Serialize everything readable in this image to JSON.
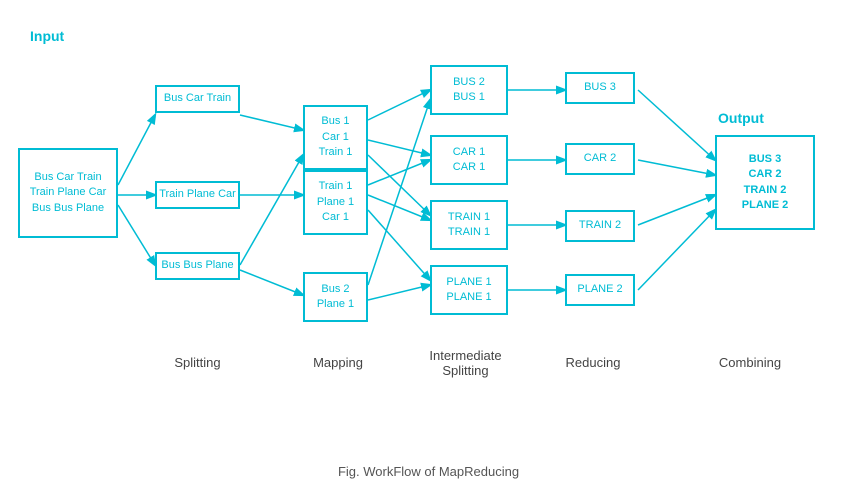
{
  "title": "Fig. WorkFlow of MapReducing",
  "labels": {
    "input": "Input",
    "output": "Output",
    "splitting": "Splitting",
    "mapping": "Mapping",
    "intermediate_splitting": "Intermediate\nSplitting",
    "reducing": "Reducing",
    "combining": "Combining",
    "fig": "Fig. WorkFlow of MapReducing"
  },
  "boxes": {
    "input": "Bus Car Train\nTrain Plane Car\nBus Bus Plane",
    "split1": "Bus Car Train",
    "split2": "Train Plane Car",
    "split3": "Bus Bus Plane",
    "map1": "Bus 1\nCar 1\nTrain 1",
    "map2": "Train 1\nPlane 1\nCar 1",
    "map3": "Bus 2\nPlane 1",
    "inter1": "BUS 2\nBUS 1",
    "inter2": "CAR 1\nCAR 1",
    "inter3": "TRAIN 1\nTRAIN 1",
    "inter4": "PLANE 1\nPLANE 1",
    "reduce1": "BUS 3",
    "reduce2": "CAR 2",
    "reduce3": "TRAIN 2",
    "reduce4": "PLANE 2",
    "output": "BUS 3\nCAR 2\nTRAIN 2\nPLANE 2"
  }
}
